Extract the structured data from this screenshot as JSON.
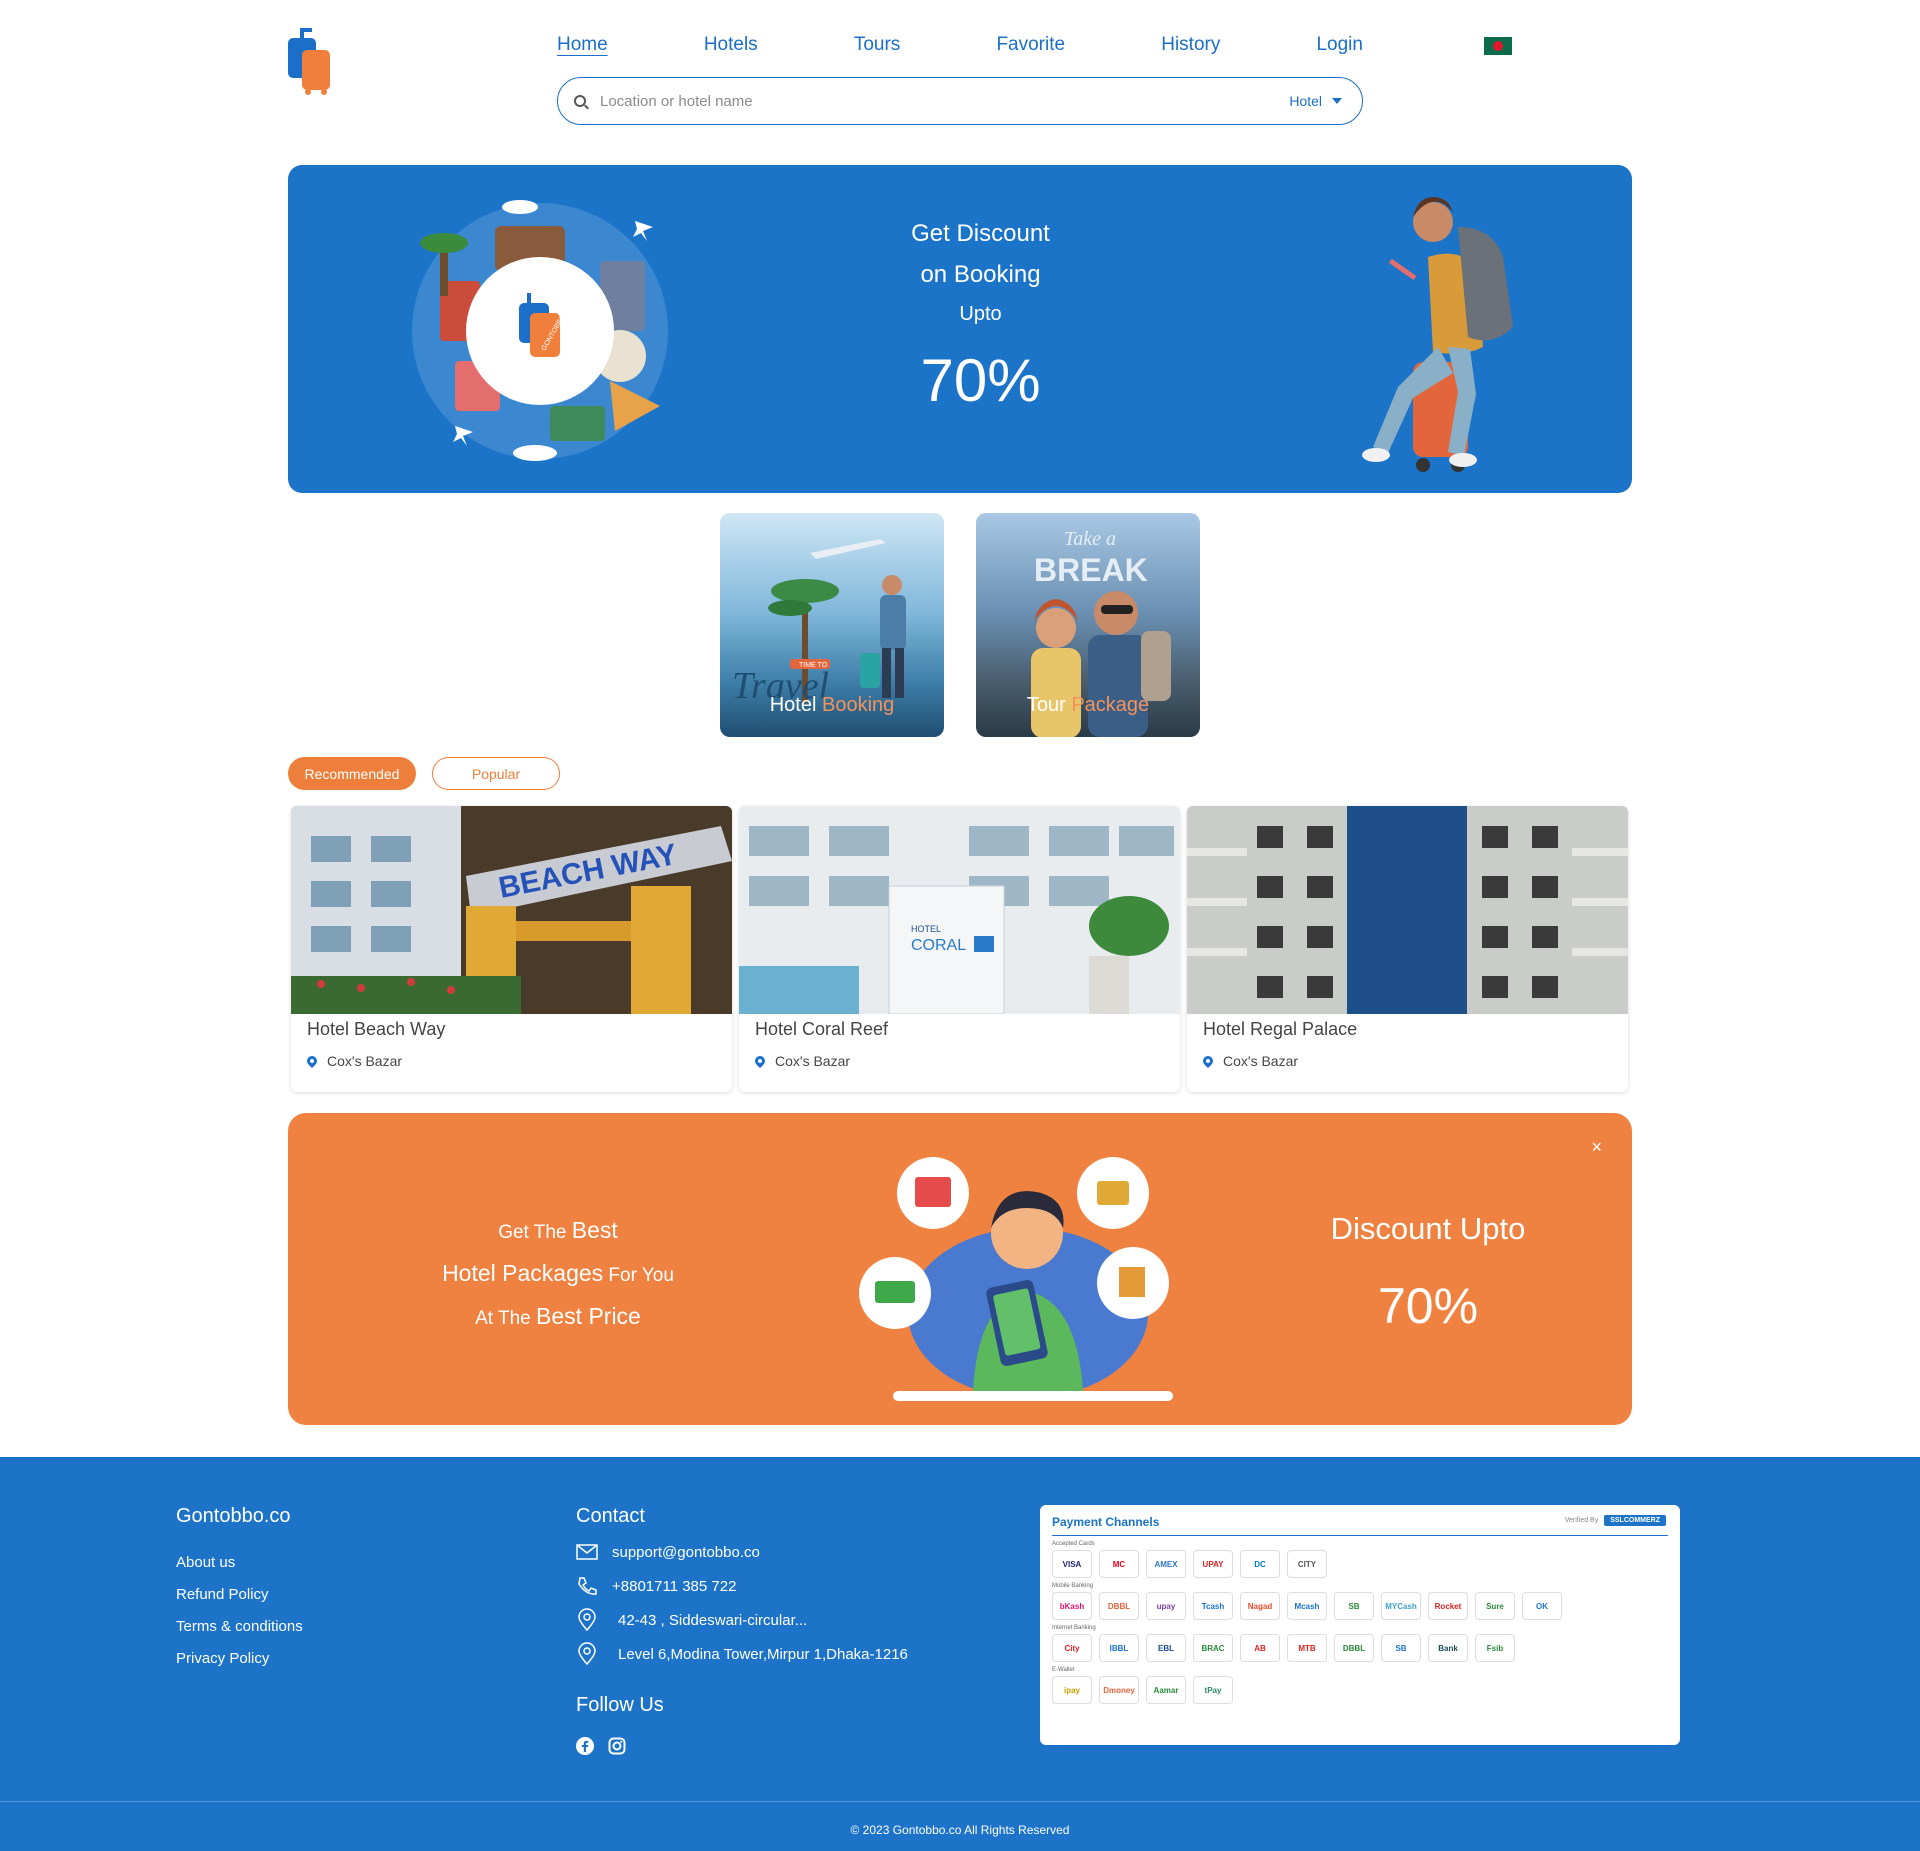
{
  "nav": {
    "items": [
      {
        "label": "Home",
        "active": true
      },
      {
        "label": "Hotels",
        "active": false
      },
      {
        "label": "Tours",
        "active": false
      },
      {
        "label": "Favorite",
        "active": false
      },
      {
        "label": "History",
        "active": false
      },
      {
        "label": "Login",
        "active": false
      }
    ]
  },
  "search": {
    "placeholder": "Location or hotel name",
    "type_selected": "Hotel"
  },
  "hero": {
    "line1": "Get Discount",
    "line2": "on Booking",
    "line3": "Upto",
    "percent": "70%",
    "logo_text": "GONTOBBO"
  },
  "categories": {
    "hotel": {
      "word1": "Hotel",
      "word2": "Booking",
      "art_text": "Travel",
      "art_small": "TIME TO"
    },
    "tour": {
      "word1": "Tour",
      "word2": "Package",
      "art_text": "BREAK",
      "art_small": "Take a"
    }
  },
  "tabs": {
    "recommended": "Recommended",
    "popular": "Popular"
  },
  "hotels": [
    {
      "name": "Hotel Beach Way",
      "location": "Cox's Bazar",
      "sign": "BEACH WAY"
    },
    {
      "name": "Hotel Coral Reef",
      "location": "Cox's Bazar",
      "sign": "CORAL"
    },
    {
      "name": "Hotel Regal Palace",
      "location": "Cox's Bazar"
    }
  ],
  "promo": {
    "l1a": "Get The ",
    "l1b": "Best",
    "l2a": "Hotel Packages",
    "l2b": " For You",
    "l3a": "At The ",
    "l3b": "Best Price",
    "discount": "Discount Upto",
    "percent": "70%",
    "close": "×"
  },
  "footer": {
    "brand": "Gontobbo.co",
    "links": [
      "About us",
      "Refund Policy",
      "Terms & conditions",
      "Privacy Policy"
    ],
    "contact_title": "Contact",
    "email": "support@gontobbo.co",
    "phone": "+8801711 385 722",
    "address1": "42-43 , Siddeswari-circular...",
    "address2": "Level 6,Modina Tower,Mirpur 1,Dhaka-1216",
    "follow": "Follow Us",
    "copyright": "© 2023 Gontobbo.co All Rights Reserved"
  },
  "payment": {
    "title": "Payment Channels",
    "verified": "Verified By",
    "verified_brand": "SSLCOMMERZ",
    "sections": [
      "Accepted Cards",
      "Mobile Banking",
      "Internet Banking",
      "E-Wallet"
    ],
    "cards": [
      "VISA",
      "MC",
      "AMEX",
      "UPAY",
      "DC",
      "CITY"
    ],
    "mobile": [
      "bKash",
      "DBBL",
      "upay",
      "Tcash",
      "Nagad",
      "Mcash",
      "SB",
      "MYCash",
      "Rocket",
      "Sure",
      "OK"
    ],
    "internet": [
      "City",
      "IBBL",
      "EBL",
      "BRAC",
      "AB",
      "MTB",
      "DBBL",
      "SB",
      "Bank",
      "Fsib"
    ],
    "ewallet": [
      "ipay",
      "Dmoney",
      "Aamar",
      "tPay"
    ]
  },
  "colors": {
    "primary_blue": "#1c74c9",
    "accent_orange": "#ef8240"
  }
}
